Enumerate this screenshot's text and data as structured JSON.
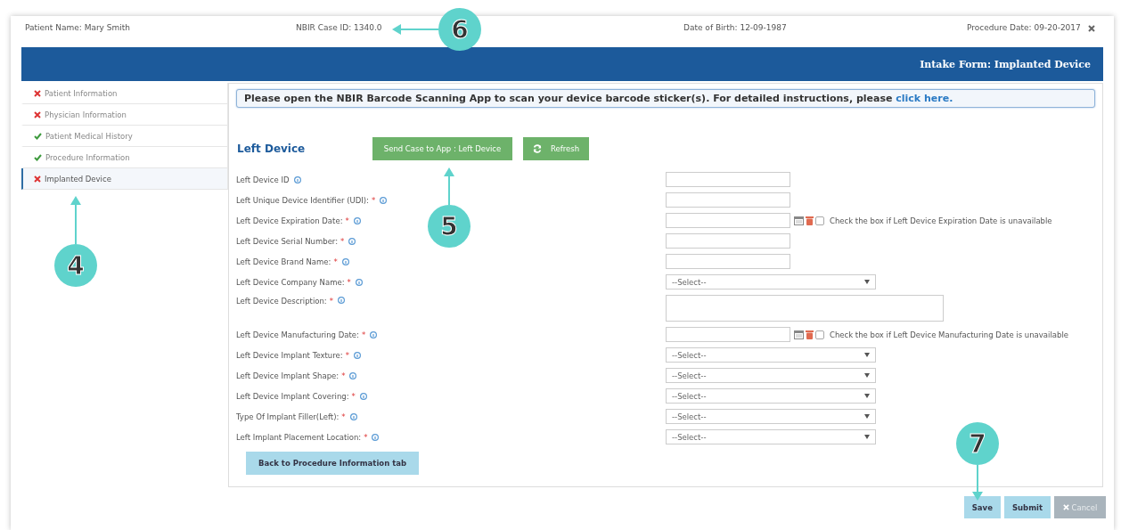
{
  "header": {
    "patient_name": "Patient Name: Mary Smith",
    "case_id": "NBIR Case ID: 1340.0",
    "date_of_birth": "Date of Birth: 12-09-1987",
    "procedure_date": "Procedure Date: 09-20-2017"
  },
  "form_title": "Intake Form: Implanted Device",
  "sidebar": {
    "items": [
      {
        "label": "Patient Information",
        "complete": false,
        "selected": false
      },
      {
        "label": "Physician Information",
        "complete": false,
        "selected": false
      },
      {
        "label": "Patient Medical History",
        "complete": true,
        "selected": false
      },
      {
        "label": "Procedure Information",
        "complete": true,
        "selected": false
      },
      {
        "label": "Implanted Device",
        "complete": false,
        "selected": true
      }
    ]
  },
  "notice": {
    "text": "Please open the NBIR Barcode Scanning App to scan your device barcode sticker(s). For detailed instructions, please",
    "link": "click here."
  },
  "section": {
    "title": "Left Device",
    "send_button": "Send Case to App : Left Device",
    "refresh_button": "Refresh"
  },
  "fields": [
    {
      "label": "Left Device ID",
      "required": false,
      "kind": "text"
    },
    {
      "label": "Left Unique Device Identifier (UDI):",
      "required": true,
      "kind": "text"
    },
    {
      "label": "Left Device Expiration Date:",
      "required": true,
      "kind": "date",
      "checkbox_label": "Check the box if Left Device Expiration Date is unavailable",
      "checked": false
    },
    {
      "label": "Left Device Serial Number:",
      "required": true,
      "kind": "text"
    },
    {
      "label": "Left Device Brand Name:",
      "required": true,
      "kind": "text"
    },
    {
      "label": "Left Device Company Name:",
      "required": true,
      "kind": "select",
      "value": "--Select--"
    },
    {
      "label": "Left Device Description:",
      "required": true,
      "kind": "textarea"
    },
    {
      "label": "Left Device Manufacturing Date:",
      "required": true,
      "kind": "date",
      "checkbox_label": "Check the box if Left Device Manufacturing Date is unavailable",
      "checked": false
    },
    {
      "label": "Left Device Implant Texture:",
      "required": true,
      "kind": "select",
      "value": "--Select--"
    },
    {
      "label": "Left Device Implant Shape:",
      "required": true,
      "kind": "select",
      "value": "--Select--"
    },
    {
      "label": "Left Device Implant Covering:",
      "required": true,
      "kind": "select",
      "value": "--Select--"
    },
    {
      "label": "Type Of Implant Filler(Left):",
      "required": true,
      "kind": "select",
      "value": "--Select--"
    },
    {
      "label": "Left Implant Placement Location:",
      "required": true,
      "kind": "select",
      "value": "--Select--"
    }
  ],
  "required_mark": "*",
  "back_button": "Back to Procedure Information tab",
  "footer_buttons": [
    {
      "label": "Save",
      "disabled": false
    },
    {
      "label": "Submit",
      "disabled": false
    },
    {
      "label": "Cancel",
      "disabled": true
    }
  ],
  "annotations": [
    {
      "number": "6",
      "kind": "left"
    },
    {
      "number": "5",
      "kind": "up"
    },
    {
      "number": "4",
      "kind": "up"
    },
    {
      "number": "7",
      "kind": "down"
    }
  ]
}
